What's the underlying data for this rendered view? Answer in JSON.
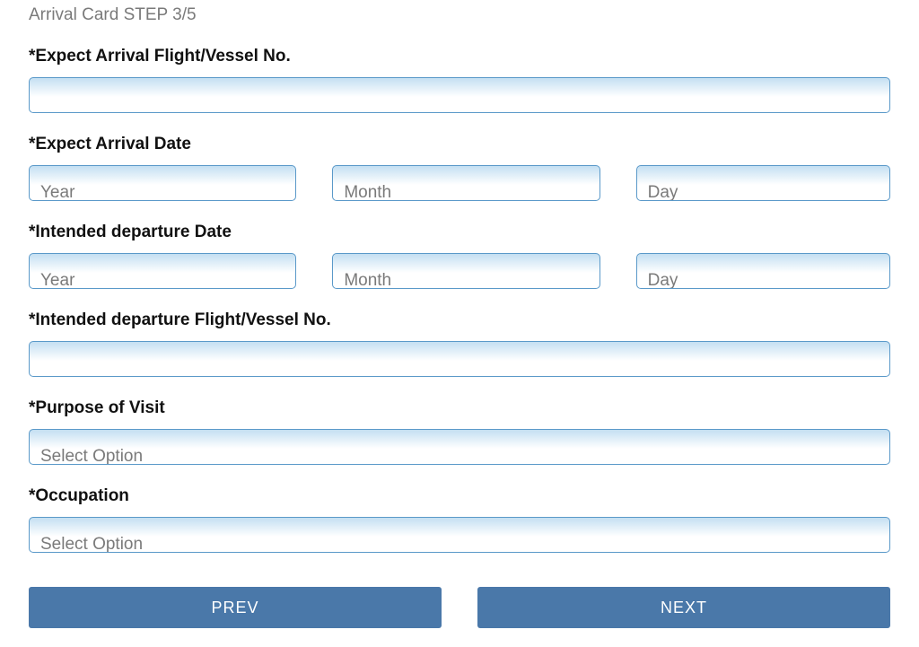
{
  "stepTitle": "Arrival Card STEP 3/5",
  "fields": {
    "arrivalFlight": {
      "label": "*Expect Arrival Flight/Vessel No.",
      "value": ""
    },
    "arrivalDate": {
      "label": "*Expect Arrival Date",
      "year": "Year",
      "month": "Month",
      "day": "Day"
    },
    "departureDate": {
      "label": "*Intended departure Date",
      "year": "Year",
      "month": "Month",
      "day": "Day"
    },
    "departureFlight": {
      "label": "*Intended departure Flight/Vessel No.",
      "value": ""
    },
    "purpose": {
      "label": "*Purpose of Visit",
      "placeholder": "Select Option"
    },
    "occupation": {
      "label": "*Occupation",
      "placeholder": "Select Option"
    }
  },
  "buttons": {
    "prev": "PREV",
    "next": "NEXT"
  }
}
